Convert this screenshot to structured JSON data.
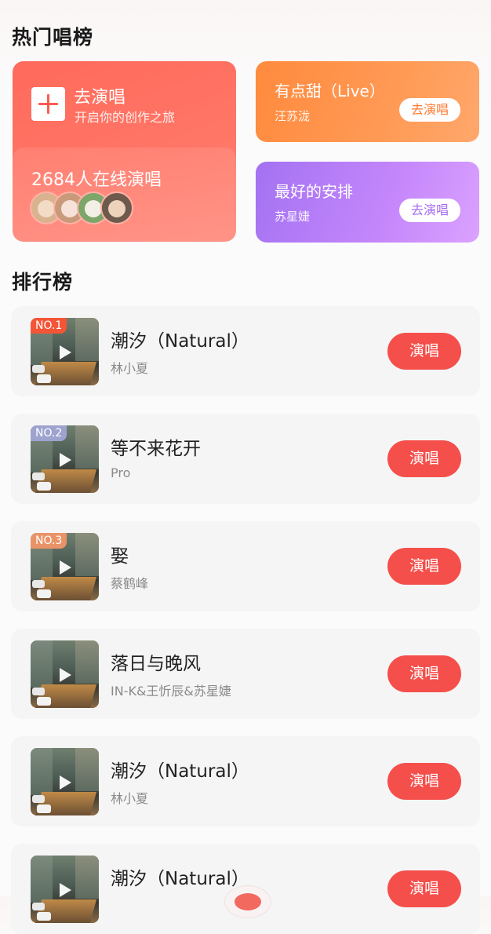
{
  "hot": {
    "title": "热门唱榜",
    "go_sing": {
      "label": "去演唱",
      "subtitle": "开启你的创作之旅",
      "online": "2684人在线演唱",
      "avatar_count": 4
    },
    "cards": [
      {
        "song": "有点甜（Live）",
        "artist": "汪苏泷",
        "button": "去演唱",
        "color": "#ff8a3d"
      },
      {
        "song": "最好的安排",
        "artist": "苏星婕",
        "button": "去演唱",
        "color": "#a372f2"
      }
    ]
  },
  "ranking": {
    "title": "排行榜",
    "items": [
      {
        "badge": "NO.1",
        "title": "潮汐（Natural）",
        "artist": "林小夏",
        "button": "演唱"
      },
      {
        "badge": "NO.2",
        "title": "等不来花开",
        "artist": "Pro",
        "button": "演唱"
      },
      {
        "badge": "NO.3",
        "title": "娶",
        "artist": "蔡鹤峰",
        "button": "演唱"
      },
      {
        "badge": "",
        "title": "落日与晚风",
        "artist": "IN-K&王忻辰&苏星婕",
        "button": "演唱"
      },
      {
        "badge": "",
        "title": "潮汐（Natural）",
        "artist": "林小夏",
        "button": "演唱"
      },
      {
        "badge": "",
        "title": "潮汐（Natural）",
        "artist": "",
        "button": "演唱"
      }
    ]
  },
  "colors": {
    "accent": "#f54f4b",
    "rank1": "#f45537",
    "rank2": "#9ea2cf",
    "rank3": "#e99468"
  }
}
